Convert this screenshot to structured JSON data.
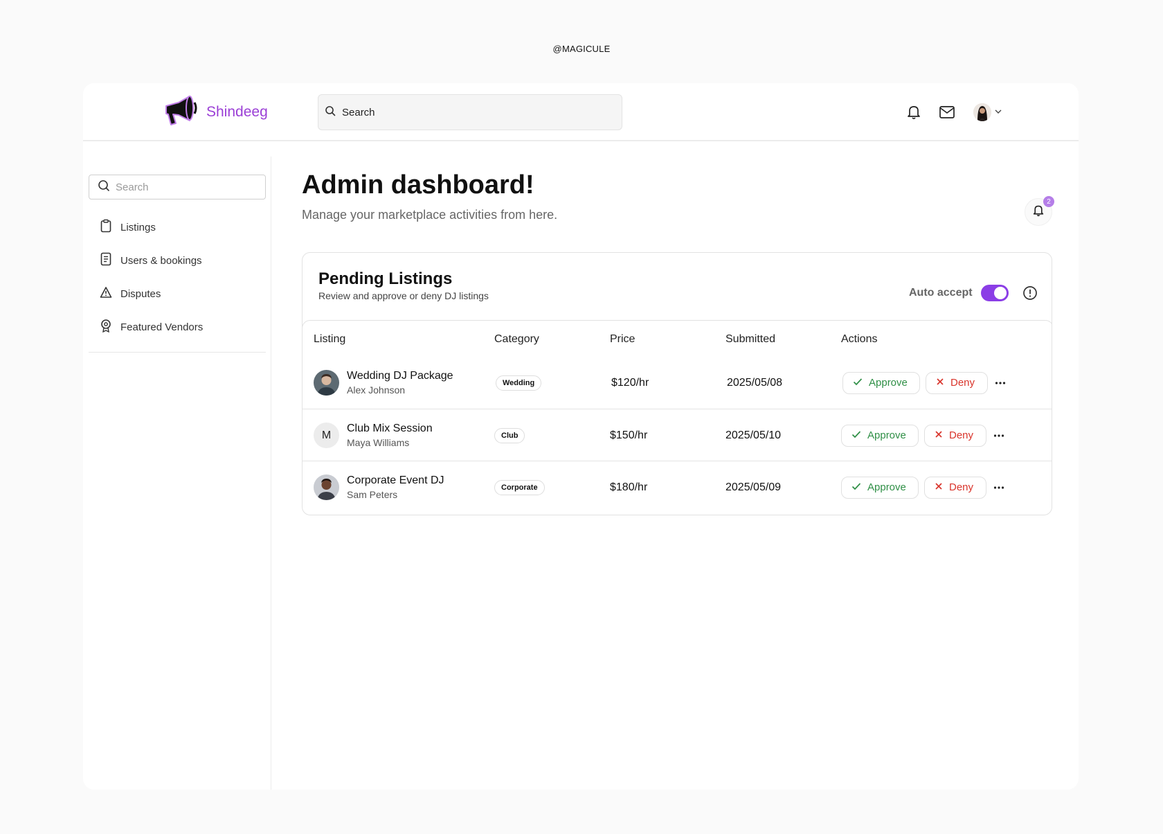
{
  "watermark": "@MAGICULE",
  "brand": {
    "name": "Shindeeg",
    "color": "#9b3fd6"
  },
  "topbar": {
    "search_placeholder": "Search",
    "icons": [
      "bell-icon",
      "mail-icon",
      "user-avatar",
      "chevron-down-icon"
    ]
  },
  "sidebar": {
    "search_placeholder": "Search",
    "items": [
      {
        "label": "Listings",
        "icon": "clipboard-icon"
      },
      {
        "label": "Users & bookings",
        "icon": "receipt-icon"
      },
      {
        "label": "Disputes",
        "icon": "warning-icon"
      },
      {
        "label": "Featured Vendors",
        "icon": "badge-icon"
      }
    ]
  },
  "page": {
    "title": "Admin dashboard!",
    "subtitle": "Manage your marketplace activities from here.",
    "notification_count": "2"
  },
  "pending": {
    "title": "Pending Listings",
    "subtitle": "Review and approve or deny DJ listings",
    "auto_accept_label": "Auto accept",
    "auto_accept_on": true,
    "columns": [
      "Listing",
      "Category",
      "Price",
      "Submitted",
      "Actions"
    ],
    "approve_label": "Approve",
    "deny_label": "Deny",
    "rows": [
      {
        "name": "Wedding DJ Package",
        "owner": "Alex Johnson",
        "avatar": "photo",
        "category": "Wedding",
        "price": "$120/hr",
        "submitted": "2025/05/08"
      },
      {
        "name": "Club Mix Session",
        "owner": "Maya Williams",
        "avatar": "M",
        "category": "Club",
        "price": "$150/hr",
        "submitted": "2025/05/10"
      },
      {
        "name": "Corporate Event DJ",
        "owner": "Sam Peters",
        "avatar": "photo",
        "category": "Corporate",
        "price": "$180/hr",
        "submitted": "2025/05/09"
      }
    ]
  },
  "colors": {
    "accent": "#8b3ee6",
    "approve": "#2f8f46",
    "deny": "#d9342b",
    "badge": "#b57ee8"
  }
}
